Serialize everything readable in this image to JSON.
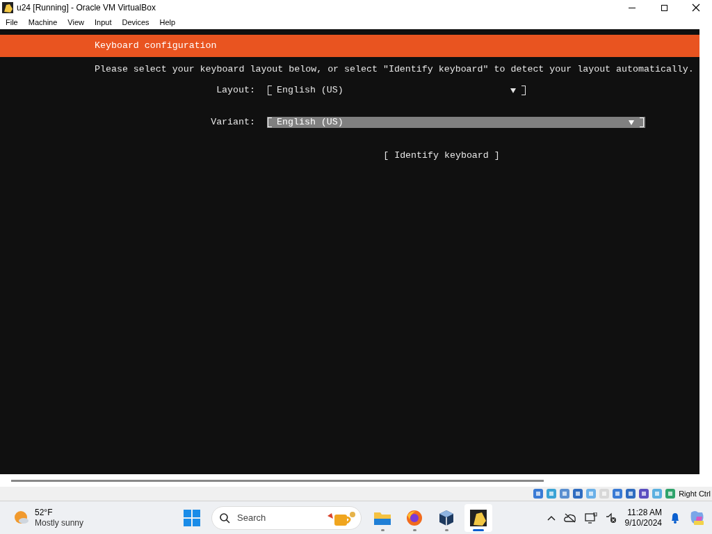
{
  "window": {
    "title": "u24 [Running] - Oracle VM VirtualBox"
  },
  "menu": [
    "File",
    "Machine",
    "View",
    "Input",
    "Devices",
    "Help"
  ],
  "installer": {
    "header": "Keyboard configuration",
    "instructions": "Please select your keyboard layout below, or select \"Identify keyboard\" to detect your layout automatically.",
    "fields": [
      {
        "label": "Layout:",
        "value": "English (US)",
        "selected": false
      },
      {
        "label": "Variant:",
        "value": "English (US)",
        "selected": true
      }
    ],
    "button": "[ Identify keyboard ]"
  },
  "status_bar": {
    "host_key": "Right Ctrl"
  },
  "taskbar": {
    "weather": {
      "temperature": "52°F",
      "condition": "Mostly sunny"
    },
    "search": {
      "placeholder": "Search"
    },
    "apps": [
      {
        "kind": "folder",
        "selected": false
      },
      {
        "kind": "firefox",
        "selected": false
      },
      {
        "kind": "virtualbox",
        "selected": false
      },
      {
        "kind": "vm",
        "selected": true
      }
    ],
    "clock": {
      "time": "11:28 AM",
      "date": "9/10/2024"
    }
  }
}
